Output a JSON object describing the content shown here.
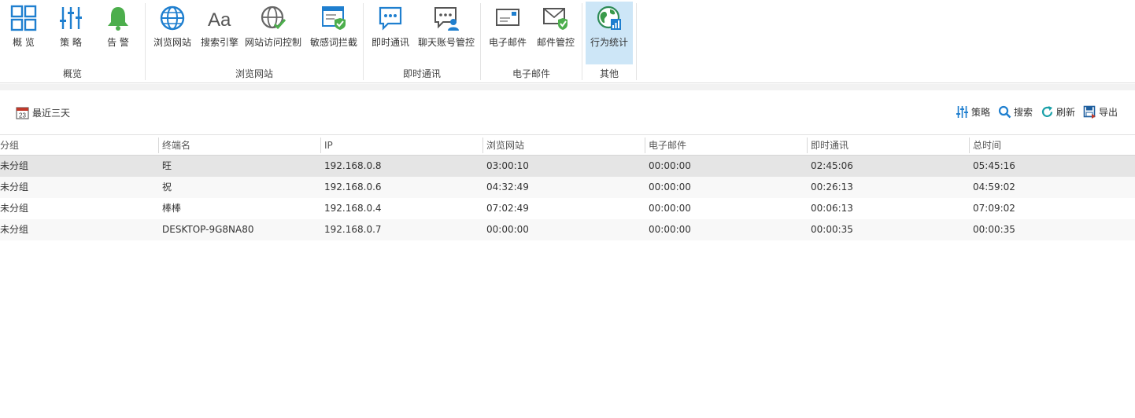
{
  "ribbon": {
    "groups": [
      {
        "label": "概览",
        "buttons": [
          {
            "label": "概 览",
            "icon": "overview-grid-icon"
          },
          {
            "label": "策 略",
            "icon": "policy-sliders-icon"
          },
          {
            "label": "告 警",
            "icon": "alarm-bell-icon"
          }
        ]
      },
      {
        "label": "浏览网站",
        "buttons": [
          {
            "label": "浏览网站",
            "icon": "globe-icon"
          },
          {
            "label": "搜索引擎",
            "icon": "search-engine-aa-icon"
          },
          {
            "label": "网站访问控制",
            "icon": "globe-check-icon"
          },
          {
            "label": "敏感词拦截",
            "icon": "sensitive-word-shield-icon"
          }
        ]
      },
      {
        "label": "即时通讯",
        "buttons": [
          {
            "label": "即时通讯",
            "icon": "chat-bubble-icon"
          },
          {
            "label": "聊天账号管控",
            "icon": "chat-account-icon"
          }
        ]
      },
      {
        "label": "电子邮件",
        "buttons": [
          {
            "label": "电子邮件",
            "icon": "email-icon"
          },
          {
            "label": "邮件管控",
            "icon": "email-shield-icon"
          }
        ]
      },
      {
        "label": "其他",
        "buttons": [
          {
            "label": "行为统计",
            "icon": "behavior-stats-icon"
          }
        ]
      }
    ]
  },
  "toolbar": {
    "date_range": "最近三天",
    "date_icon_day": "23",
    "policy": "策略",
    "search": "搜索",
    "refresh": "刷新",
    "export": "导出"
  },
  "table": {
    "columns": [
      "分组",
      "终端名",
      "IP",
      "浏览网站",
      "电子邮件",
      "即时通讯",
      "总时间"
    ],
    "rows": [
      [
        "未分组",
        "旺",
        "192.168.0.8",
        "03:00:10",
        "00:00:00",
        "02:45:06",
        "05:45:16"
      ],
      [
        "未分组",
        "祝",
        "192.168.0.6",
        "04:32:49",
        "00:00:00",
        "00:26:13",
        "04:59:02"
      ],
      [
        "未分组",
        "棒棒",
        "192.168.0.4",
        "07:02:49",
        "00:00:00",
        "00:06:13",
        "07:09:02"
      ],
      [
        "未分组",
        "DESKTOP-9G8NA80",
        "192.168.0.7",
        "00:00:00",
        "00:00:00",
        "00:00:35",
        "00:00:35"
      ]
    ]
  },
  "colors": {
    "accent_blue": "#1f7fcf",
    "alarm_green": "#4cae4c",
    "active_bg": "#cde6f7"
  }
}
